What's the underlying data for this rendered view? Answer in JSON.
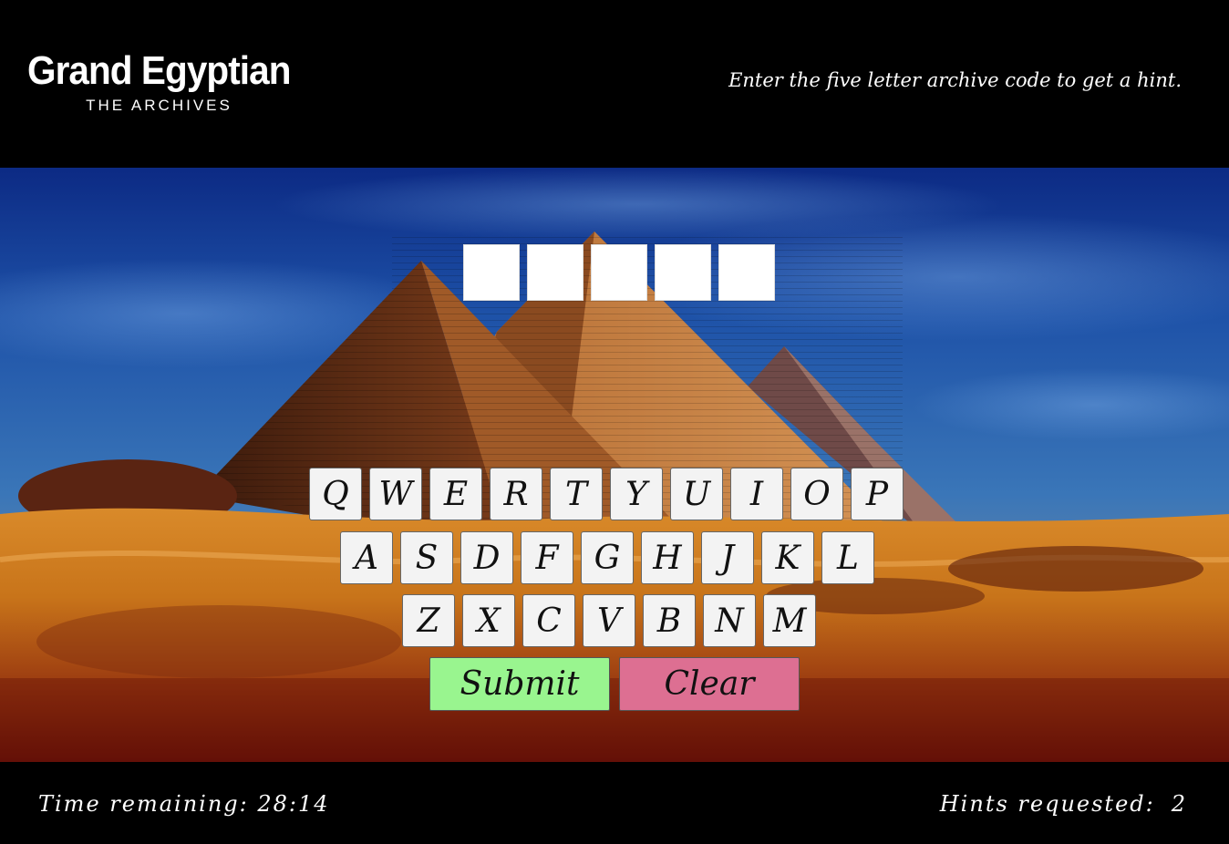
{
  "brand": {
    "title": "Grand Egyptian",
    "subtitle": "THE ARCHIVES"
  },
  "instruction": "Enter the five letter archive code to get a hint.",
  "code": {
    "slots": [
      "",
      "",
      "",
      "",
      ""
    ]
  },
  "keyboard": {
    "rows": [
      [
        "Q",
        "W",
        "E",
        "R",
        "T",
        "Y",
        "U",
        "I",
        "O",
        "P"
      ],
      [
        "A",
        "S",
        "D",
        "F",
        "G",
        "H",
        "J",
        "K",
        "L"
      ],
      [
        "Z",
        "X",
        "C",
        "V",
        "B",
        "N",
        "M"
      ]
    ]
  },
  "actions": {
    "submit_label": "Submit",
    "clear_label": "Clear"
  },
  "footer": {
    "timer_label": "Time remaining: 28:14",
    "hints_label": "Hints requested:",
    "hints_count": "2"
  },
  "colors": {
    "submit": "#99f58f",
    "clear": "#dd6f92",
    "sky_top": "#0d2f8f",
    "sand": "#c8741a"
  }
}
